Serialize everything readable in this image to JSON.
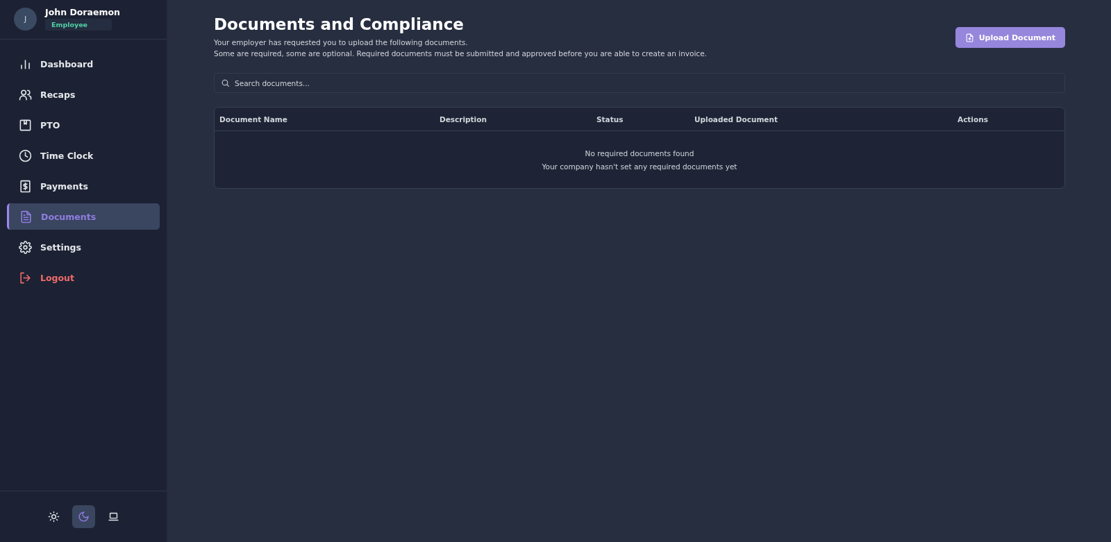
{
  "user": {
    "initial": "J",
    "name": "John Doraemon",
    "role": "Employee"
  },
  "nav": [
    {
      "label": "Dashboard",
      "kind": "chart",
      "selected": false
    },
    {
      "label": "Recaps",
      "kind": "people",
      "selected": false
    },
    {
      "label": "PTO",
      "kind": "bookmark",
      "selected": false
    },
    {
      "label": "Time Clock",
      "kind": "clock",
      "selected": false
    },
    {
      "label": "Payments",
      "kind": "dollar",
      "selected": false
    },
    {
      "label": "Documents",
      "kind": "document",
      "selected": true
    },
    {
      "label": "Settings",
      "kind": "gear",
      "selected": false
    },
    {
      "label": "Logout",
      "kind": "logout",
      "selected": false
    }
  ],
  "theme": [
    {
      "kind": "sun",
      "selected": false
    },
    {
      "kind": "moon",
      "selected": true
    },
    {
      "kind": "laptop",
      "selected": false
    }
  ],
  "page": {
    "title": "Documents and Compliance",
    "subtitle": [
      "Your employer has requested you to upload the following documents.",
      "Some are required, some are optional. Required documents must be submitted and approved before you are able to create an invoice."
    ],
    "upload_button": "Upload Document"
  },
  "search": {
    "placeholder": "Search documents..."
  },
  "table": {
    "columns": [
      "Document Name",
      "Description",
      "Status",
      "Uploaded Document",
      "Actions"
    ],
    "empty": {
      "title": "No required documents found",
      "message": "Your company hasn't set any required documents yet"
    }
  }
}
